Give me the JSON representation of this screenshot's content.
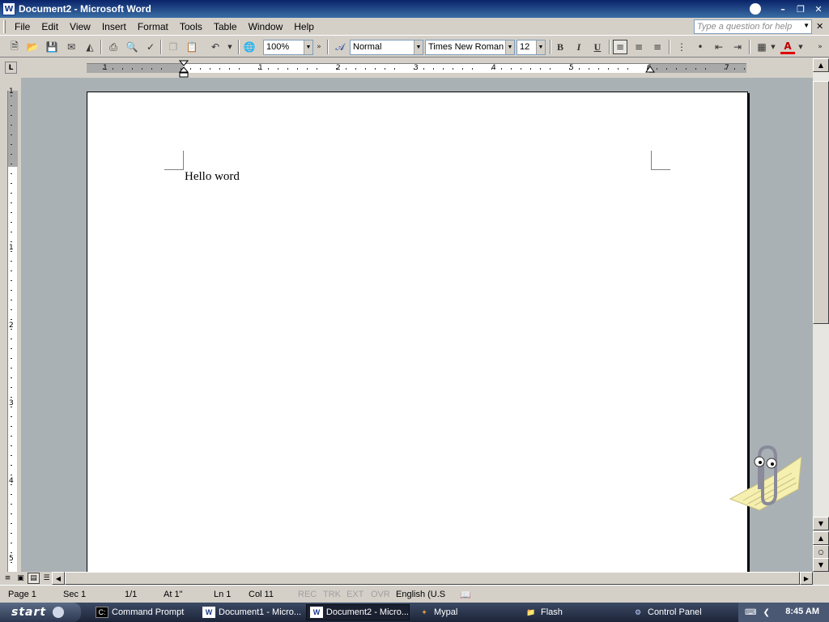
{
  "window": {
    "title": "Document2 - Microsoft Word",
    "app_icon": "W"
  },
  "menu": {
    "items": [
      "File",
      "Edit",
      "View",
      "Insert",
      "Format",
      "Tools",
      "Table",
      "Window",
      "Help"
    ],
    "help_placeholder": "Type a question for help"
  },
  "toolbar": {
    "zoom": "100%",
    "style": "Normal",
    "font": "Times New Roman",
    "font_size": "12",
    "bold_label": "B",
    "italic_label": "I",
    "underline_label": "U",
    "font_color_label": "A"
  },
  "ruler": {
    "numbers": [
      "1",
      "1",
      "2",
      "3",
      "4",
      "5",
      "6",
      "7"
    ],
    "vertical_numbers": [
      "1",
      "1",
      "2",
      "3",
      "4",
      "5"
    ],
    "tab_selector": "L"
  },
  "document": {
    "text": "Hello word"
  },
  "status": {
    "page": "Page  1",
    "section": "Sec  1",
    "page_of": "1/1",
    "at": "At  1\"",
    "line": "Ln  1",
    "col": "Col  11",
    "rec": "REC",
    "trk": "TRK",
    "ext": "EXT",
    "ovr": "OVR",
    "language": "English (U.S"
  },
  "taskbar": {
    "start_label": "start",
    "tasks": [
      "Command Prompt",
      "Document1 - Micro...",
      "Document2 - Micro...",
      "Mypal",
      "Flash",
      "Control Panel"
    ],
    "clock": "8:45 AM"
  }
}
